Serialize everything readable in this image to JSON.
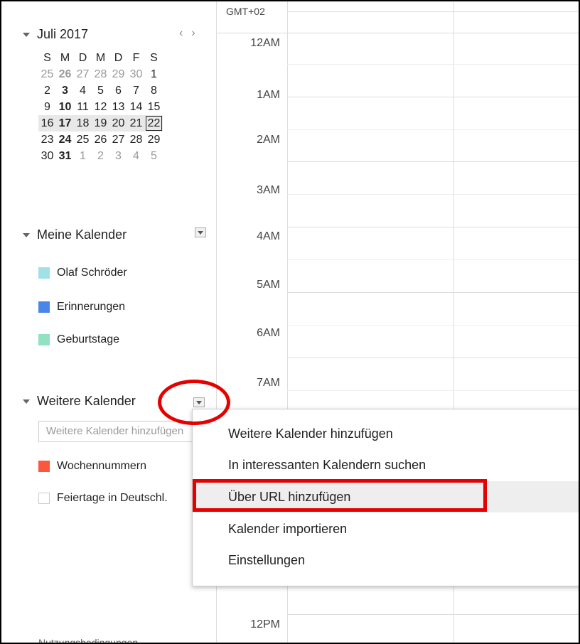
{
  "mini_calendar": {
    "month_label": "Juli 2017",
    "prev_icon": "chevron-left-icon",
    "next_icon": "chevron-right-icon",
    "weekdays": [
      "S",
      "M",
      "D",
      "M",
      "D",
      "F",
      "S"
    ],
    "weeks": [
      [
        "25",
        "26",
        "27",
        "28",
        "29",
        "30",
        "1"
      ],
      [
        "2",
        "3",
        "4",
        "5",
        "6",
        "7",
        "8"
      ],
      [
        "9",
        "10",
        "11",
        "12",
        "13",
        "14",
        "15"
      ],
      [
        "16",
        "17",
        "18",
        "19",
        "20",
        "21",
        "22"
      ],
      [
        "23",
        "24",
        "25",
        "26",
        "27",
        "28",
        "29"
      ],
      [
        "30",
        "31",
        "1",
        "2",
        "3",
        "4",
        "5"
      ]
    ],
    "today": "22"
  },
  "my_calendars": {
    "title": "Meine Kalender",
    "items": [
      {
        "label": "Olaf Schröder",
        "color": "#9fe1e7"
      },
      {
        "label": "Erinnerungen",
        "color": "#4a86e8"
      },
      {
        "label": "Geburtstage",
        "color": "#92e1c0"
      }
    ]
  },
  "other_calendars": {
    "title": "Weitere Kalender",
    "input_placeholder": "Weitere Kalender hinzufügen",
    "items": [
      {
        "label": "Wochennummern",
        "color": "#fa573c"
      },
      {
        "label": "Feiertage in Deutschl.",
        "color": "#ffffff"
      }
    ]
  },
  "footer": {
    "terms_link": "Nutzungsbedingungen"
  },
  "grid": {
    "timezone": "GMT+02",
    "hours": [
      "12AM",
      "1AM",
      "2AM",
      "3AM",
      "4AM",
      "5AM",
      "6AM",
      "7AM",
      "12PM"
    ]
  },
  "menu": {
    "items": [
      "Weitere Kalender hinzufügen",
      "In interessanten Kalendern suchen",
      "Über URL hinzufügen",
      "Kalender importieren",
      "Einstellungen"
    ],
    "highlighted_index": 2
  },
  "annotation_color": "#e60000"
}
